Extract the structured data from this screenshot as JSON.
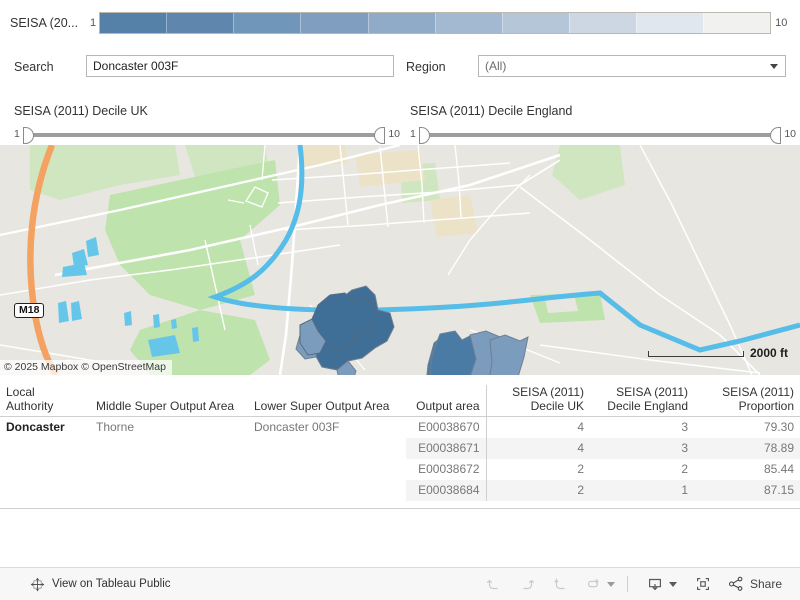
{
  "legend": {
    "title": "SEISA (20...",
    "min": "1",
    "max": "10",
    "colors": [
      "#5581a9",
      "#5f87ad",
      "#7096b9",
      "#809fc0",
      "#90abc7",
      "#a3b9d1",
      "#b6c6d9",
      "#ccd7e3",
      "#e0e7ee",
      "#f1f1ef"
    ]
  },
  "filters": {
    "search_label": "Search",
    "search_value": "Doncaster 003F",
    "search_placeholder": "Search",
    "region_label": "Region",
    "region_value": "(All)"
  },
  "sliders": [
    {
      "title": "SEISA (2011) Decile UK",
      "min": "1",
      "max": "10"
    },
    {
      "title": "SEISA (2011) Decile England",
      "min": "1",
      "max": "10"
    }
  ],
  "map": {
    "attribution": "© 2025 Mapbox © OpenStreetMap",
    "scale_label": "2000 ft",
    "motorway_shield": "M18",
    "areas": [
      {
        "id": "E00038670",
        "fill": "#7c9cbe"
      },
      {
        "id": "E00038671",
        "fill": "#7c9cbe"
      },
      {
        "id": "E00038672",
        "fill": "#4a7ba5"
      },
      {
        "id": "E00038684",
        "fill": "#3f6e97"
      }
    ]
  },
  "table": {
    "columns": [
      {
        "key": "local_authority",
        "label": "Local Authority",
        "align": "left"
      },
      {
        "key": "msoa",
        "label": "Middle Super Output Area",
        "align": "left"
      },
      {
        "key": "lsoa",
        "label": "Lower Super Output Area",
        "align": "left"
      },
      {
        "key": "output_area",
        "label": "Output area",
        "align": "right"
      },
      {
        "key": "decile_uk",
        "label": "SEISA (2011) Decile UK",
        "align": "right"
      },
      {
        "key": "decile_england",
        "label": "SEISA (2011) Decile England",
        "align": "right"
      },
      {
        "key": "proportion",
        "label": "SEISA (2011) Proportion",
        "align": "right"
      }
    ],
    "header_lines": {
      "c0": [
        "Local",
        "Authority"
      ],
      "c1": [
        "",
        "Middle Super Output Area"
      ],
      "c2": [
        "",
        "Lower Super Output Area"
      ],
      "c3": [
        "",
        "Output area"
      ],
      "c4": [
        "SEISA (2011)",
        "Decile UK"
      ],
      "c5": [
        "SEISA (2011)",
        "Decile England"
      ],
      "c6": [
        "SEISA (2011)",
        "Proportion"
      ]
    },
    "rows": [
      {
        "local_authority": "Doncaster",
        "msoa": "Thorne",
        "lsoa": "Doncaster 003F",
        "output_area": "E00038670",
        "decile_uk": "4",
        "decile_england": "3",
        "proportion": "79.30"
      },
      {
        "local_authority": "",
        "msoa": "",
        "lsoa": "",
        "output_area": "E00038671",
        "decile_uk": "4",
        "decile_england": "3",
        "proportion": "78.89"
      },
      {
        "local_authority": "",
        "msoa": "",
        "lsoa": "",
        "output_area": "E00038672",
        "decile_uk": "2",
        "decile_england": "2",
        "proportion": "85.44"
      },
      {
        "local_authority": "",
        "msoa": "",
        "lsoa": "",
        "output_area": "E00038684",
        "decile_uk": "2",
        "decile_england": "1",
        "proportion": "87.15"
      }
    ]
  },
  "toolbar": {
    "view_on_tableau": "View on Tableau Public",
    "share_label": "Share"
  }
}
